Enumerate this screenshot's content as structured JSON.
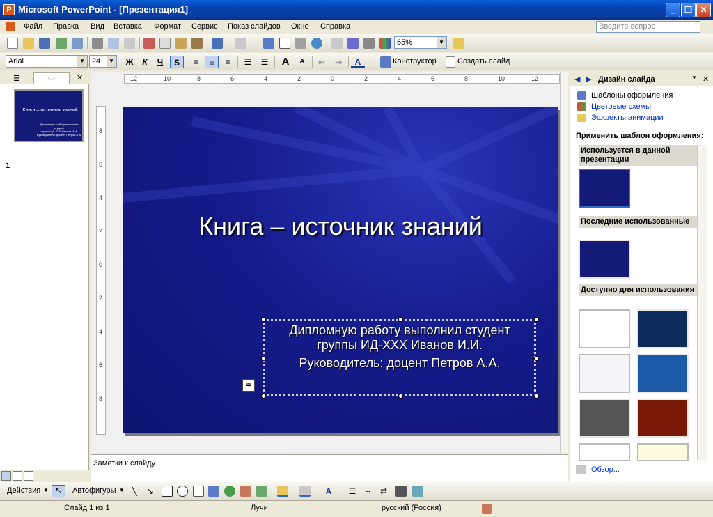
{
  "window": {
    "title": "Microsoft PowerPoint - [Презентация1]",
    "min": "_",
    "max": "❐",
    "close": "✕"
  },
  "menu": [
    "Файл",
    "Правка",
    "Вид",
    "Вставка",
    "Формат",
    "Сервис",
    "Показ слайдов",
    "Окно",
    "Справка"
  ],
  "help_placeholder": "Введите вопрос",
  "toolbar": {
    "zoom": "65%",
    "font": "Arial",
    "size": "24",
    "bold": "Ж",
    "italic": "К",
    "underline": "Ч",
    "shadow": "S",
    "designer": "Конструктор",
    "new_slide": "Создать слайд"
  },
  "outline": {
    "slide_number": "1",
    "thumb_title": "Книга – источник знаний",
    "thumb_sub1": "Дипломную работу выполнил студент",
    "thumb_sub2": "группы ИД-XXX Иванов И.И.",
    "thumb_sub3": "Руководитель: доцент Петров А.А."
  },
  "ruler": {
    "h_labels": [
      "12",
      "10",
      "8",
      "6",
      "4",
      "2",
      "0",
      "2",
      "4",
      "6",
      "8",
      "10",
      "12"
    ],
    "v_labels": [
      "8",
      "6",
      "4",
      "2",
      "0",
      "2",
      "4",
      "6",
      "8"
    ]
  },
  "slide": {
    "title": "Книга – источник знаний",
    "sub1": "Дипломную работу выполнил студент",
    "sub2": "группы ИД-XXX Иванов И.И.",
    "sub3": "Руководитель: доцент Петров А.А."
  },
  "notes": "Заметки к слайду",
  "taskpane": {
    "title": "Дизайн слайда",
    "link1": "Шаблоны оформления",
    "link2": "Цветовые схемы",
    "link3": "Эффекты анимации",
    "apply": "Применить шаблон оформления:",
    "sec1": "Используется в данной презентации",
    "sec2": "Последние использованные",
    "sec3": "Доступно для использования",
    "browse": "Обзор..."
  },
  "drawbar": {
    "actions": "Действия",
    "autoshapes": "Автофигуры"
  },
  "status": {
    "slide": "Слайд 1 из 1",
    "design": "Лучи",
    "language": "русский (Россия)"
  }
}
